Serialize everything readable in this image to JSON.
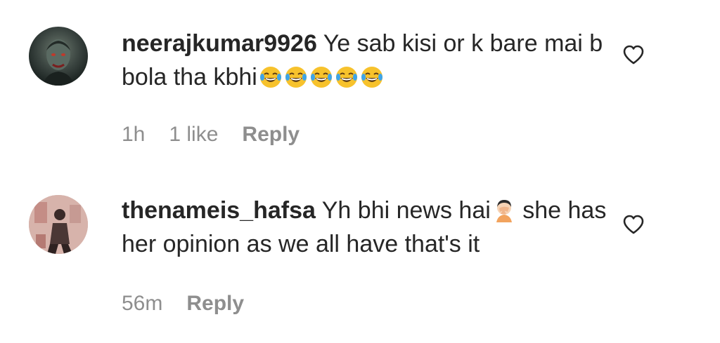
{
  "comments": [
    {
      "username": "neerajkumar9926",
      "text": "Ye sab kisi or k bare mai b bola tha kbhi",
      "emoji": [
        "tears-of-joy",
        "tears-of-joy",
        "tears-of-joy",
        "tears-of-joy",
        "tears-of-joy"
      ],
      "time": "1h",
      "likes": "1 like",
      "reply_label": "Reply",
      "like_icon": "heart-outline"
    },
    {
      "username": "thenameis_hafsa",
      "text_before_emoji": "Yh bhi news hai",
      "emoji": [
        "person-facepalming"
      ],
      "text_after_emoji": " she has her opinion as we all have that's it",
      "time": "56m",
      "reply_label": "Reply",
      "like_icon": "heart-outline"
    }
  ],
  "colors": {
    "text": "#262626",
    "meta": "#8e8e8e",
    "background": "#ffffff"
  }
}
